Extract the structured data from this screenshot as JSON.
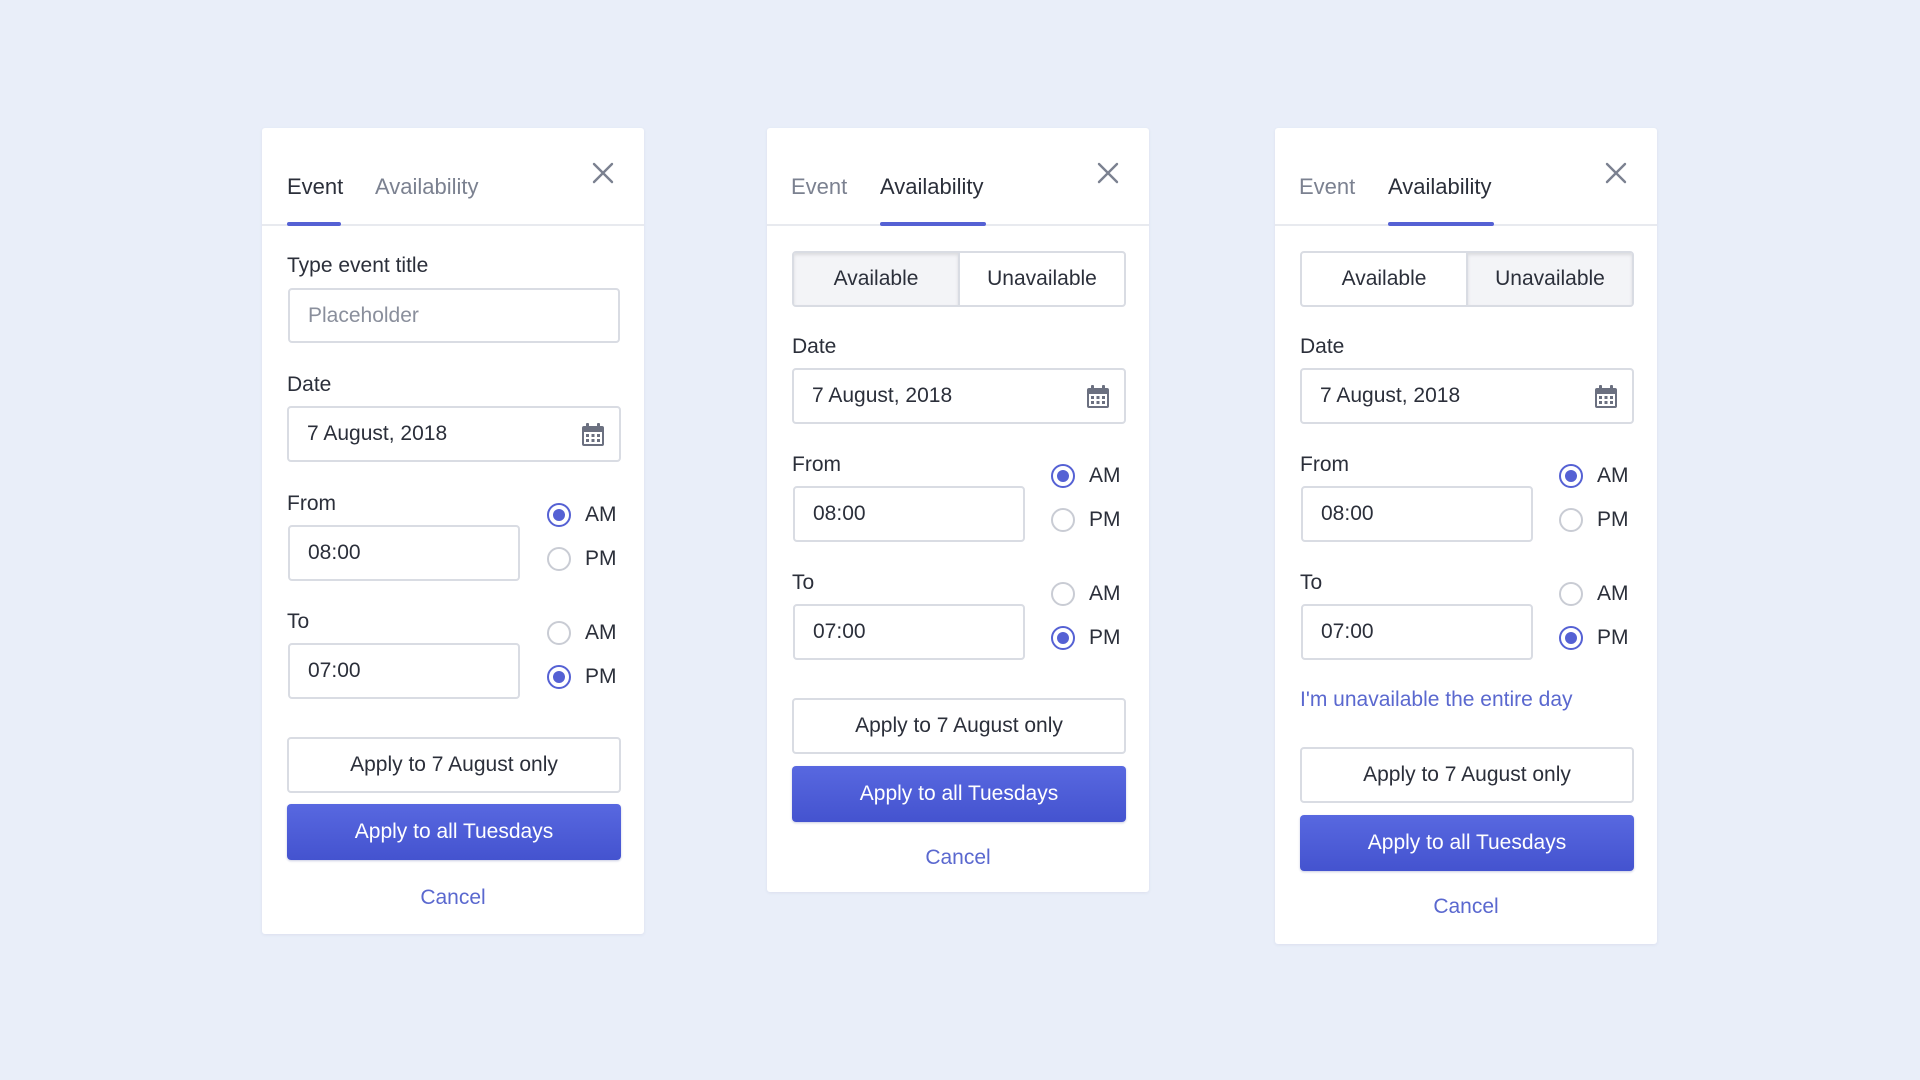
{
  "colors": {
    "background": "#e9eef9",
    "accent": "#5561d4",
    "primary_button": "#4a59d8",
    "link": "#5a68cf"
  },
  "cards": [
    {
      "tabs": [
        "Event",
        "Availability"
      ],
      "active_tab": "Event",
      "title_label": "Type event title",
      "title_placeholder": "Placeholder",
      "date_label": "Date",
      "date_value": "7 August, 2018",
      "from_label": "From",
      "from_value": "08:00",
      "from_period": "AM",
      "to_label": "To",
      "to_value": "07:00",
      "to_period": "PM",
      "am_label": "AM",
      "pm_label": "PM",
      "apply_once": "Apply to 7 August only",
      "apply_all": "Apply to all Tuesdays",
      "cancel": "Cancel",
      "close_icon": "close-icon",
      "calendar_icon": "calendar-icon"
    },
    {
      "tabs": [
        "Event",
        "Availability"
      ],
      "active_tab": "Availability",
      "segments": [
        "Available",
        "Unavailable"
      ],
      "selected_segment": "Available",
      "date_label": "Date",
      "date_value": "7 August, 2018",
      "from_label": "From",
      "from_value": "08:00",
      "from_period": "AM",
      "to_label": "To",
      "to_value": "07:00",
      "to_period": "PM",
      "am_label": "AM",
      "pm_label": "PM",
      "apply_once": "Apply to 7 August only",
      "apply_all": "Apply to all Tuesdays",
      "cancel": "Cancel",
      "close_icon": "close-icon",
      "calendar_icon": "calendar-icon"
    },
    {
      "tabs": [
        "Event",
        "Availability"
      ],
      "active_tab": "Availability",
      "segments": [
        "Available",
        "Unavailable"
      ],
      "selected_segment": "Unavailable",
      "date_label": "Date",
      "date_value": "7 August, 2018",
      "from_label": "From",
      "from_value": "08:00",
      "from_period": "AM",
      "to_label": "To",
      "to_value": "07:00",
      "to_period": "PM",
      "am_label": "AM",
      "pm_label": "PM",
      "entire_day_link": "I'm unavailable the entire day",
      "apply_once": "Apply to 7 August only",
      "apply_all": "Apply to all Tuesdays",
      "cancel": "Cancel",
      "close_icon": "close-icon",
      "calendar_icon": "calendar-icon"
    }
  ]
}
